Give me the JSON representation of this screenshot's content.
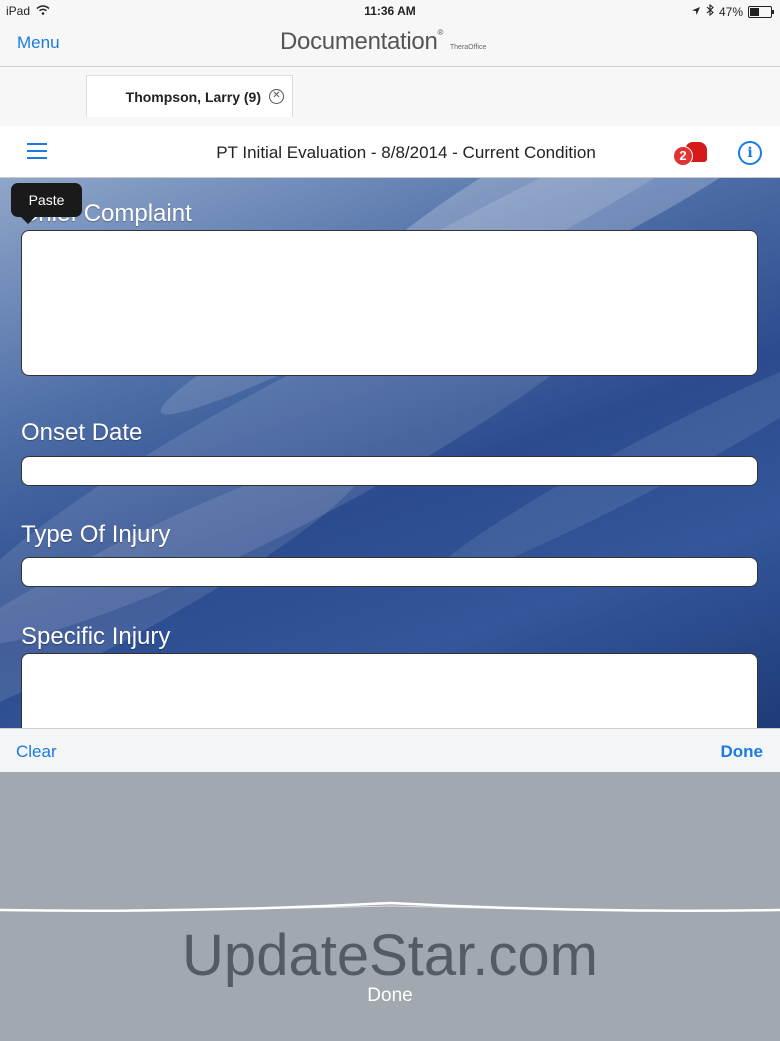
{
  "status_bar": {
    "device": "iPad",
    "time": "11:36 AM",
    "battery": "47%",
    "battery_level": 0.47
  },
  "navbar": {
    "menu_label": "Menu",
    "logo_text": "Documentation",
    "logo_sub": "TheraOffice"
  },
  "patient_tab": {
    "name": "Thompson, Larry (9)"
  },
  "section": {
    "title": "PT Initial Evaluation - 8/8/2014 - Current Condition",
    "alarm_count": "2",
    "alarm_color": "#d61a1a",
    "accent_color": "#1a7be0"
  },
  "popup": {
    "paste_label": "Paste"
  },
  "form": {
    "fields": [
      {
        "label": "Chief Complaint",
        "value": ""
      },
      {
        "label": "Onset Date",
        "value": ""
      },
      {
        "label": "Type Of Injury",
        "value": ""
      },
      {
        "label": "Specific Injury",
        "value": ""
      }
    ]
  },
  "keyboard_toolbar": {
    "clear_label": "Clear",
    "done_label": "Done"
  },
  "dictation": {
    "watermark": "UpdateStar.com",
    "done_label": "Done"
  }
}
